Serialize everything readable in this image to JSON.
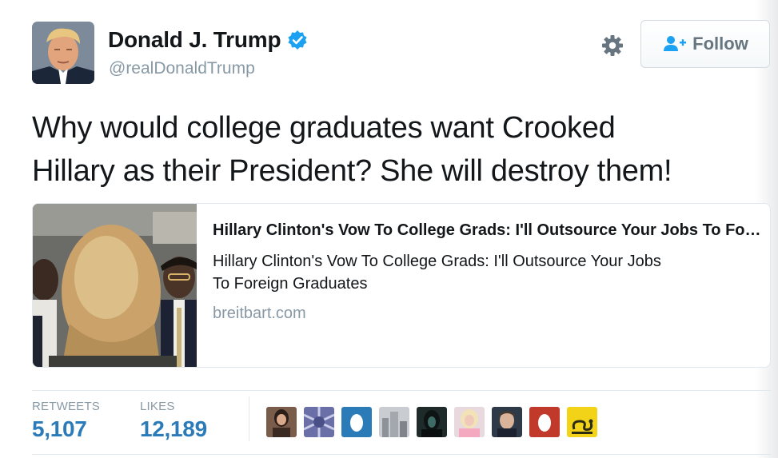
{
  "header": {
    "display_name": "Donald J. Trump",
    "handle": "@realDonaldTrump",
    "follow_label": "Follow",
    "icons": {
      "verified": "verified-badge-icon",
      "gear": "gear-icon",
      "follow": "add-user-icon"
    }
  },
  "tweet": {
    "text_line1": "Why would college graduates want Crooked",
    "text_line2": "Hillary as their President? She will destroy them!"
  },
  "card": {
    "title": "Hillary Clinton's Vow To College Grads: I'll Outsource Your Jobs To Foreign Graduates",
    "description_line1": "Hillary Clinton's Vow To College Grads: I'll Outsource Your Jobs",
    "description_line2": "To Foreign Graduates",
    "domain": "breitbart.com"
  },
  "stats": {
    "retweets_label": "RETWEETS",
    "retweets_value": "5,107",
    "likes_label": "LIKES",
    "likes_value": "12,189"
  },
  "likers": [
    "avatar-photo",
    "avatar-pattern",
    "default-egg-avatar-blue",
    "avatar-city",
    "avatar-dark",
    "avatar-portrait",
    "avatar-man",
    "default-egg-avatar-red",
    "avatar-gadsden-flag"
  ],
  "colors": {
    "link_blue": "#2b7bb9",
    "verified_blue": "#1da1f2",
    "muted_gray": "#8899a6",
    "text": "#14171a",
    "border": "#e1e8ed"
  }
}
